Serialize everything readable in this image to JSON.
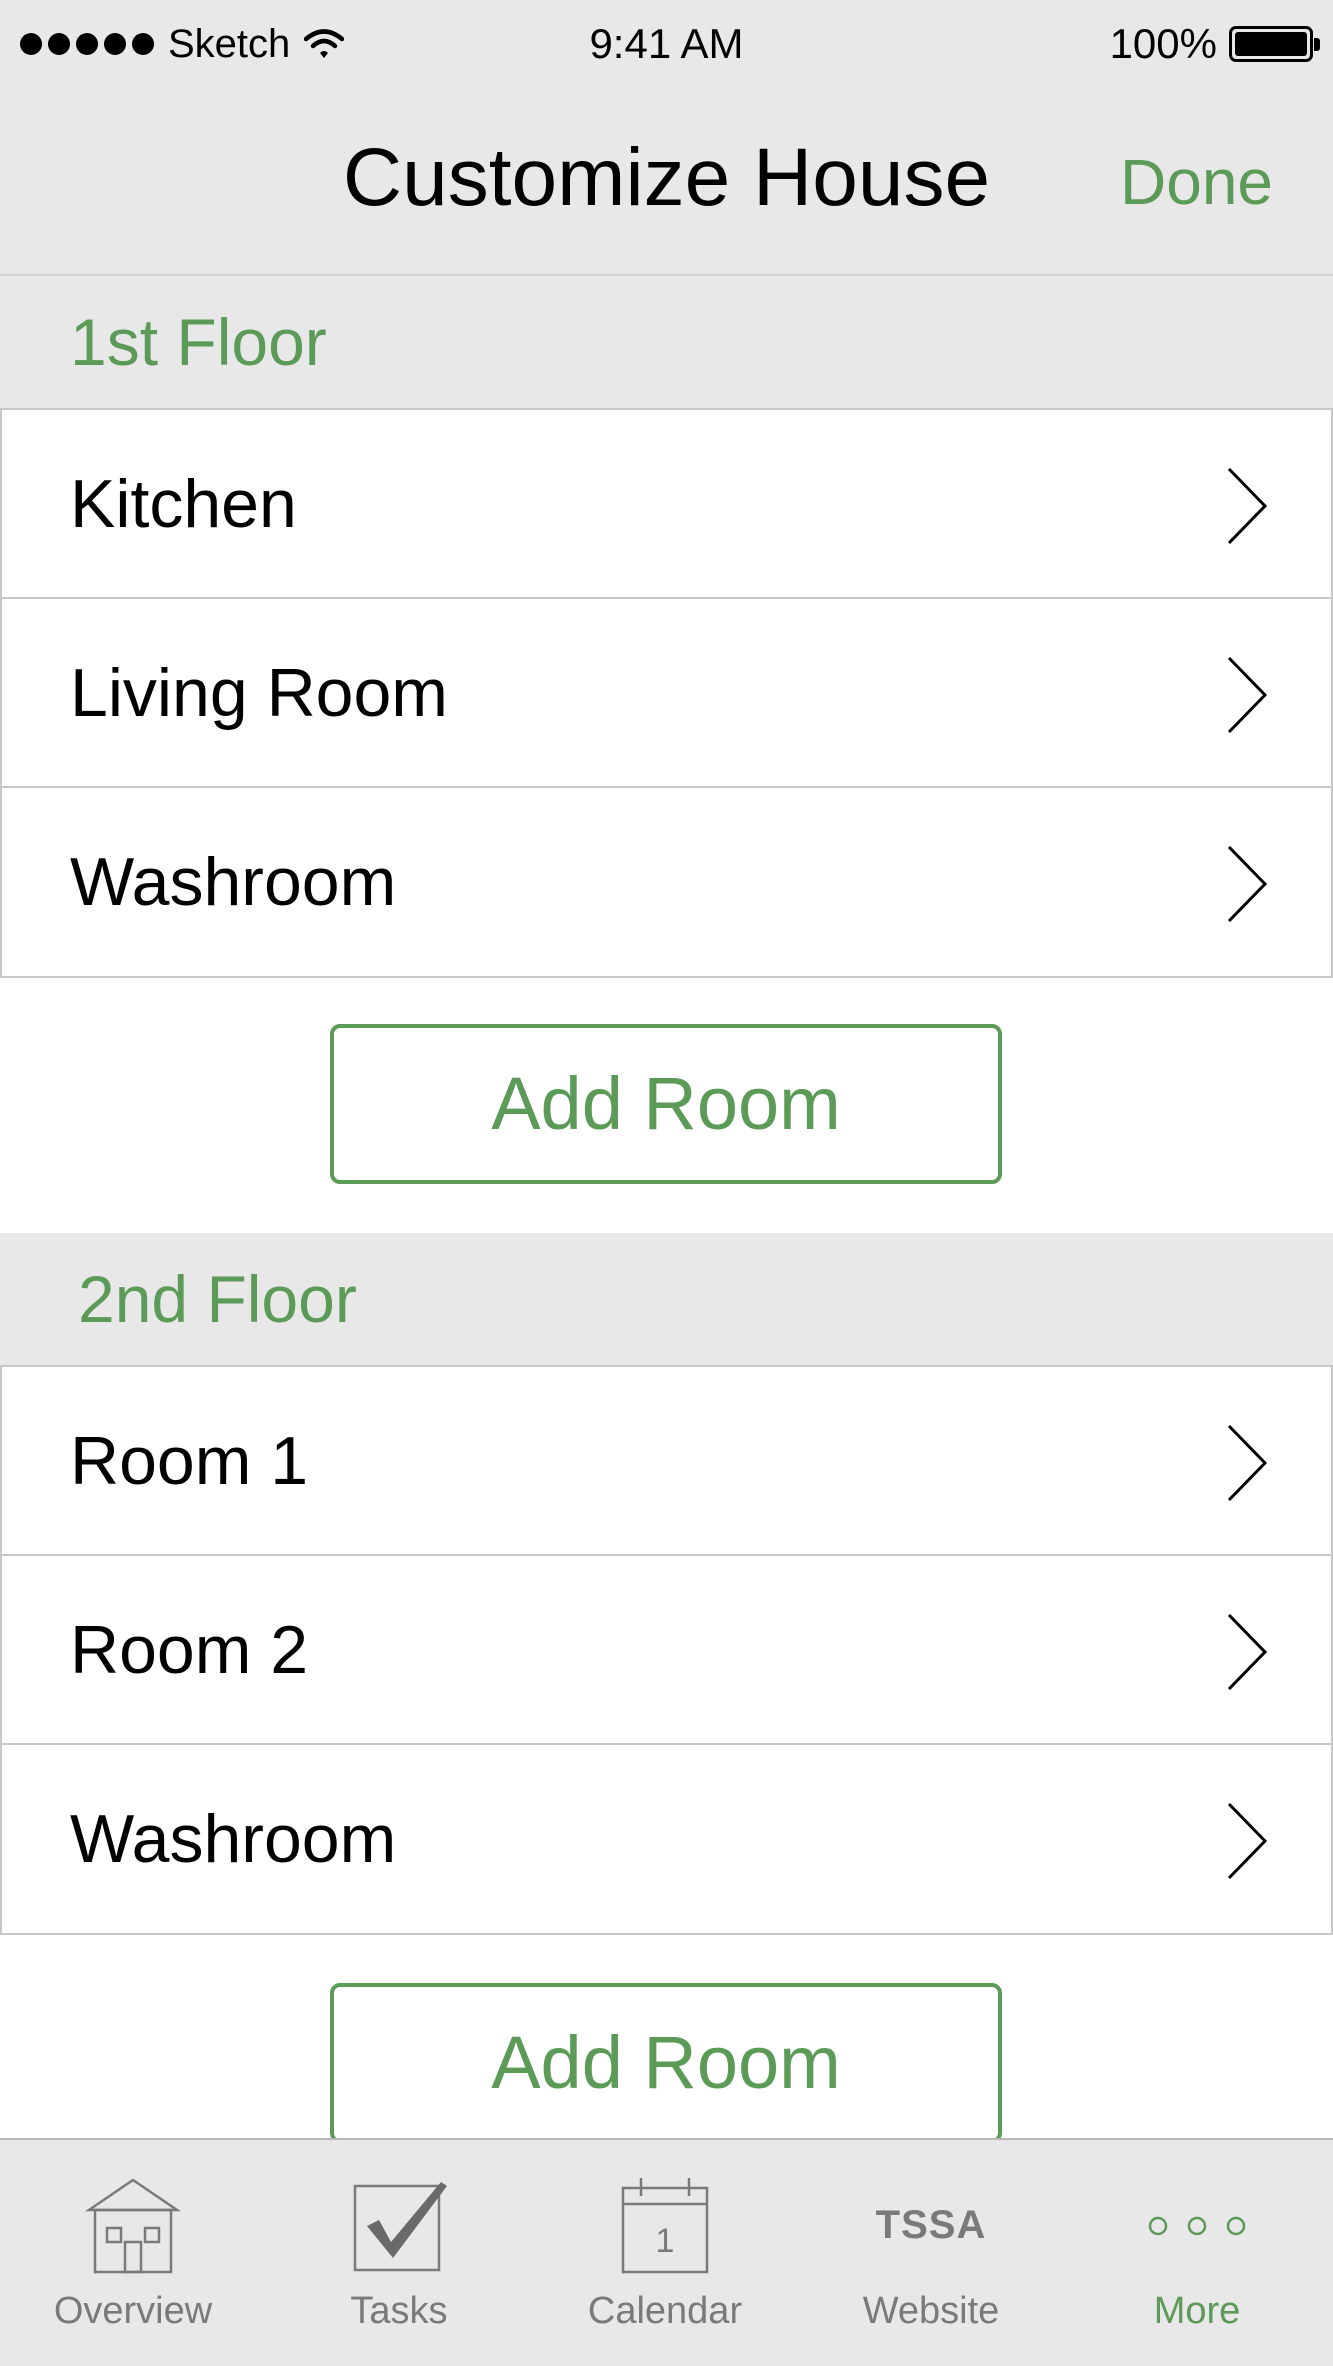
{
  "status_bar": {
    "carrier": "Sketch",
    "time": "9:41 AM",
    "battery": "100%"
  },
  "nav": {
    "title": "Customize House",
    "done_label": "Done"
  },
  "floors": [
    {
      "name": "1st Floor",
      "rooms": [
        "Kitchen",
        "Living Room",
        "Washroom"
      ],
      "add_label": "Add Room"
    },
    {
      "name": "2nd Floor",
      "rooms": [
        "Room 1",
        "Room 2",
        "Washroom"
      ],
      "add_label": "Add Room"
    }
  ],
  "tabs": [
    {
      "label": "Overview",
      "icon": "house-icon"
    },
    {
      "label": "Tasks",
      "icon": "checkbox-icon"
    },
    {
      "label": "Calendar",
      "icon": "calendar-icon"
    },
    {
      "label": "Website",
      "icon": "tssa-logo-icon",
      "logo_text": "TSSA"
    },
    {
      "label": "More",
      "icon": "more-dots-icon",
      "active": true
    }
  ],
  "colors": {
    "accent": "#5b9a57",
    "bar_background": "#e8e8e8",
    "inactive_tab": "#7a7a7a"
  }
}
